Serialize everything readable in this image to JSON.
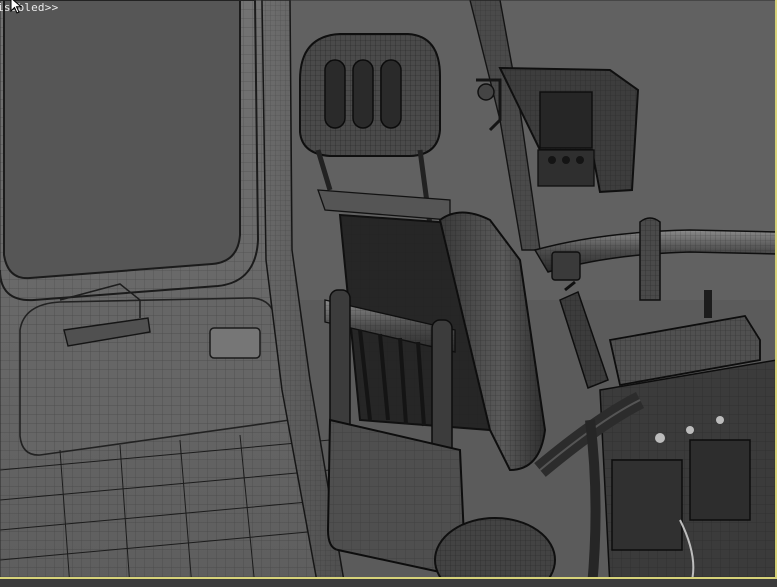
{
  "viewport": {
    "label": "isabled>>",
    "active_border_color": "#d7d37a",
    "render_mode": "wireframe-on-shaded"
  },
  "icons": {
    "cursor": "mouse-pointer-icon"
  }
}
